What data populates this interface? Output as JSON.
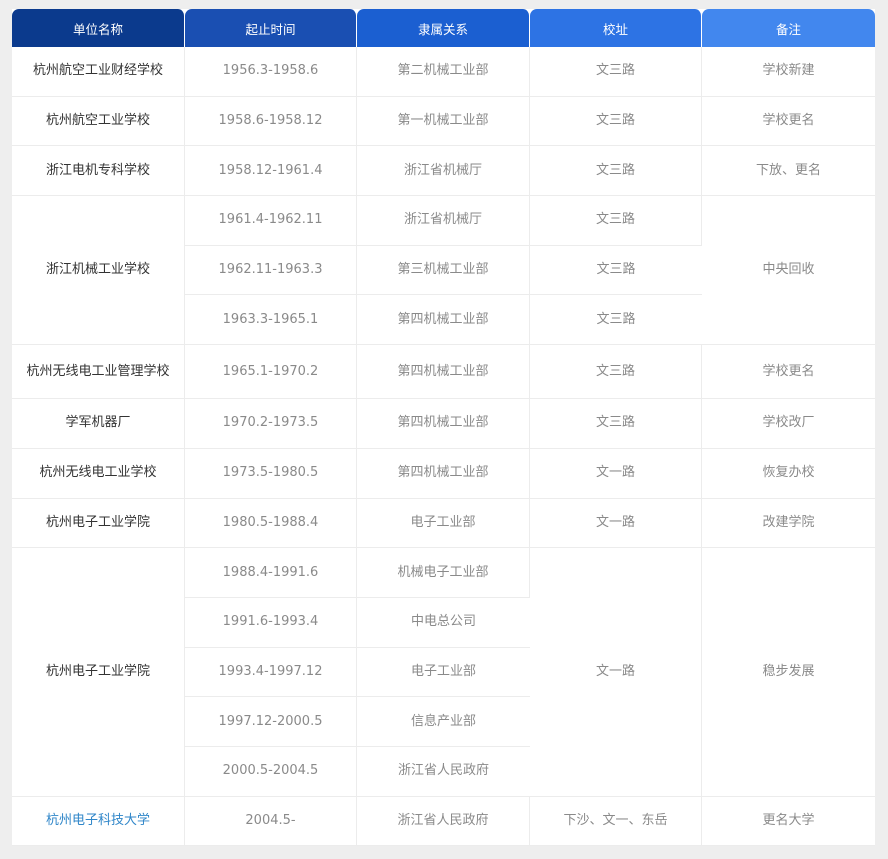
{
  "headers": [
    "单位名称",
    "起止时间",
    "隶属关系",
    "校址",
    "备注"
  ],
  "rows": [
    {
      "name": "杭州航空工业财经学校",
      "period": "1956.3-1958.6",
      "affiliation": "第二机械工业部",
      "address": "文三路",
      "note": "学校新建"
    },
    {
      "name": "杭州航空工业学校",
      "period": "1958.6-1958.12",
      "affiliation": "第一机械工业部",
      "address": "文三路",
      "note": "学校更名"
    },
    {
      "name": "浙江电机专科学校",
      "period": "1958.12-1961.4",
      "affiliation": "浙江省机械厅",
      "address": "文三路",
      "note": "下放、更名"
    },
    {
      "name": "浙江机械工业学校",
      "period": "1961.4-1962.11",
      "affiliation": "浙江省机械厅",
      "address": "文三路",
      "note": "中央回收"
    },
    {
      "period": "1962.11-1963.3",
      "affiliation": "第三机械工业部",
      "address": "文三路"
    },
    {
      "period": "1963.3-1965.1",
      "affiliation": "第四机械工业部",
      "address": "文三路"
    },
    {
      "name": "杭州无线电工业管理学校",
      "period": "1965.1-1970.2",
      "affiliation": "第四机械工业部",
      "address": "文三路",
      "note": "学校更名"
    },
    {
      "name": "学军机器厂",
      "period": "1970.2-1973.5",
      "affiliation": "第四机械工业部",
      "address": "文三路",
      "note": "学校改厂"
    },
    {
      "name": "杭州无线电工业学校",
      "period": "1973.5-1980.5",
      "affiliation": "第四机械工业部",
      "address": "文一路",
      "note": "恢复办校"
    },
    {
      "name": "杭州电子工业学院",
      "period": "1980.5-1988.4",
      "affiliation": "电子工业部",
      "address": "文一路",
      "note": "改建学院"
    },
    {
      "name": "杭州电子工业学院",
      "period": "1988.4-1991.6",
      "affiliation": "机械电子工业部",
      "address": "文一路",
      "note": "稳步发展"
    },
    {
      "period": "1991.6-1993.4",
      "affiliation": "中电总公司"
    },
    {
      "period": "1993.4-1997.12",
      "affiliation": "电子工业部"
    },
    {
      "period": "1997.12-2000.5",
      "affiliation": "信息产业部"
    },
    {
      "period": "2000.5-2004.5",
      "affiliation": "浙江省人民政府"
    },
    {
      "name": "杭州电子科技大学",
      "period": "2004.5-",
      "affiliation": "浙江省人民政府",
      "address": "下沙、文一、东岳",
      "note": "更名大学"
    }
  ]
}
